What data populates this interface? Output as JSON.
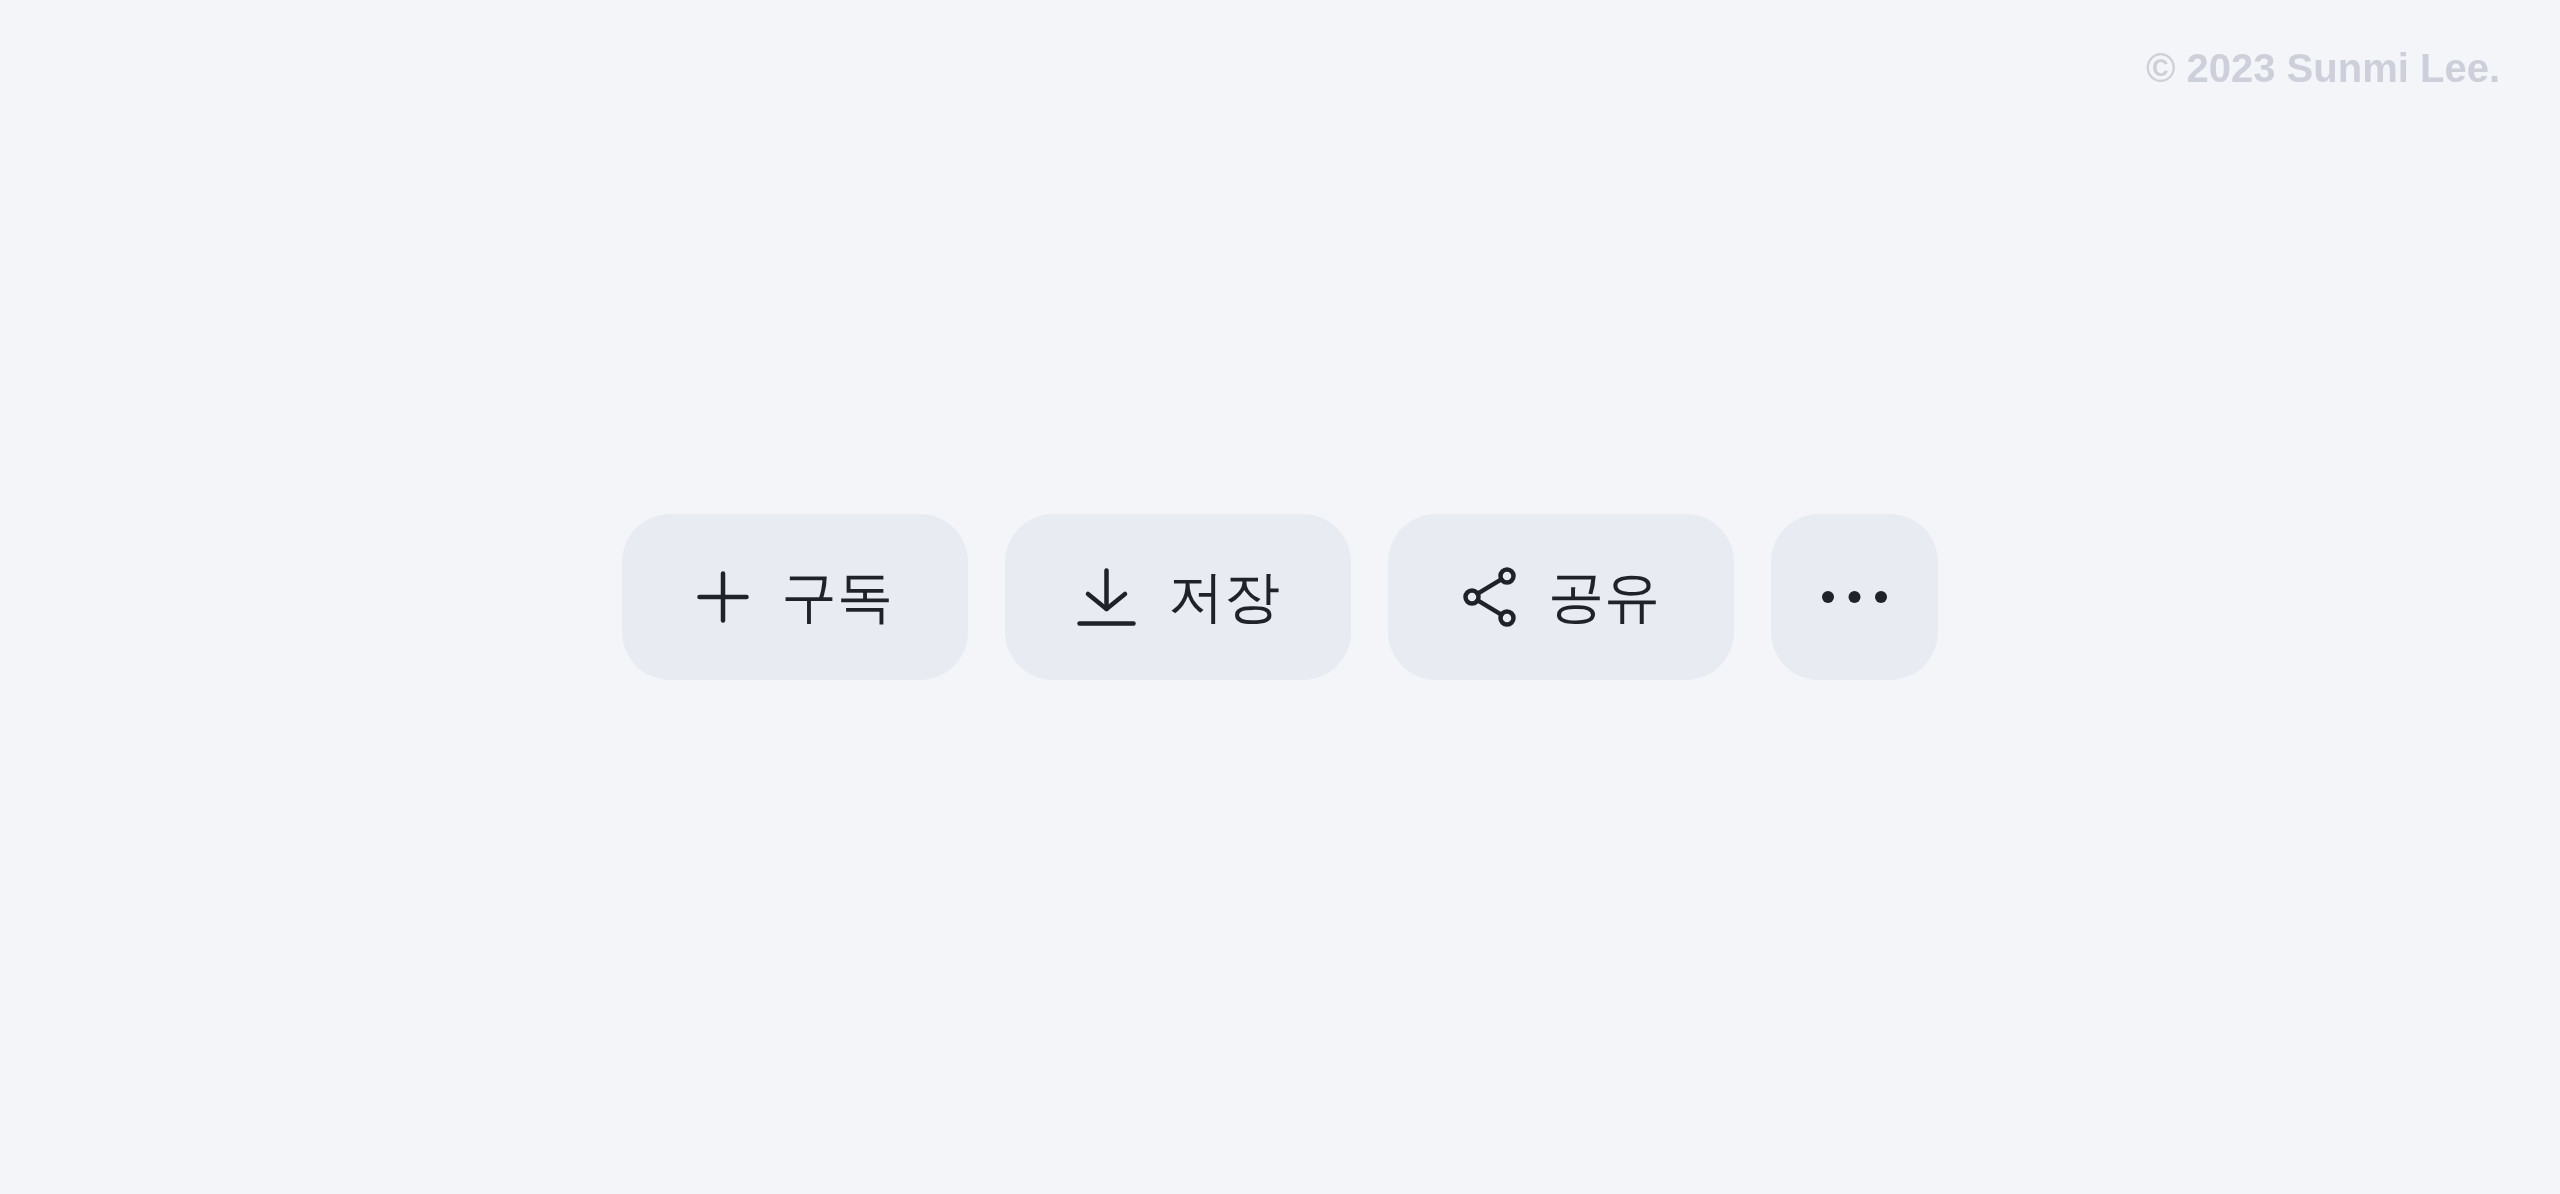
{
  "copyright": "© 2023 Sunmi Lee.",
  "actions": [
    {
      "kind": "subscribe",
      "label": "구독"
    },
    {
      "kind": "save",
      "label": "저장"
    },
    {
      "kind": "share",
      "label": "공유"
    },
    {
      "kind": "more"
    }
  ]
}
